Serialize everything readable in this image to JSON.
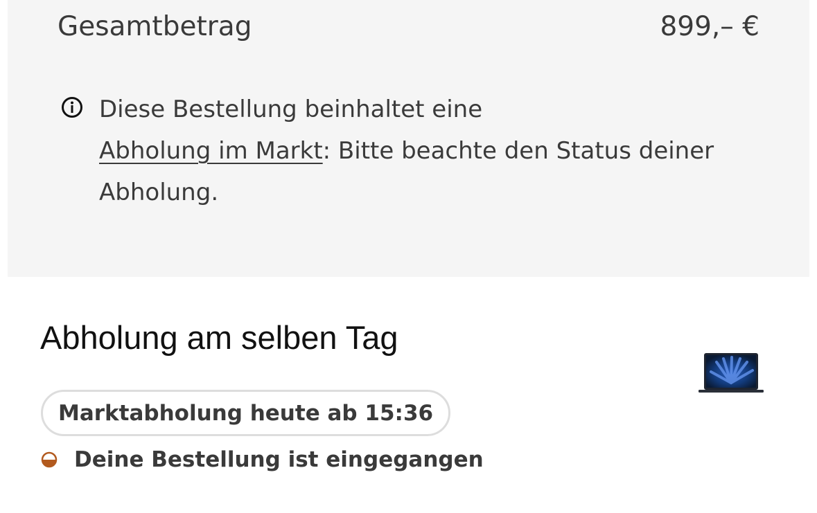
{
  "summary": {
    "total_label": "Gesamtbetrag",
    "total_value": "899,– €",
    "info": {
      "icon": "info-icon",
      "text_before": "Diese Bestellung beinhaltet eine ",
      "link_label": "Abholung im Markt",
      "text_after": ": Bitte beachte den Status deiner Abholung."
    }
  },
  "pickup": {
    "title": "Abholung am selben Tag",
    "product_image": "laptop-thumbnail",
    "time_badge": "Marktabholung heute ab 15:36",
    "status_icon": "half-filled-circle-icon",
    "status_text": "Deine Bestellung ist eingegangen",
    "status_color": "#b25a1e"
  }
}
